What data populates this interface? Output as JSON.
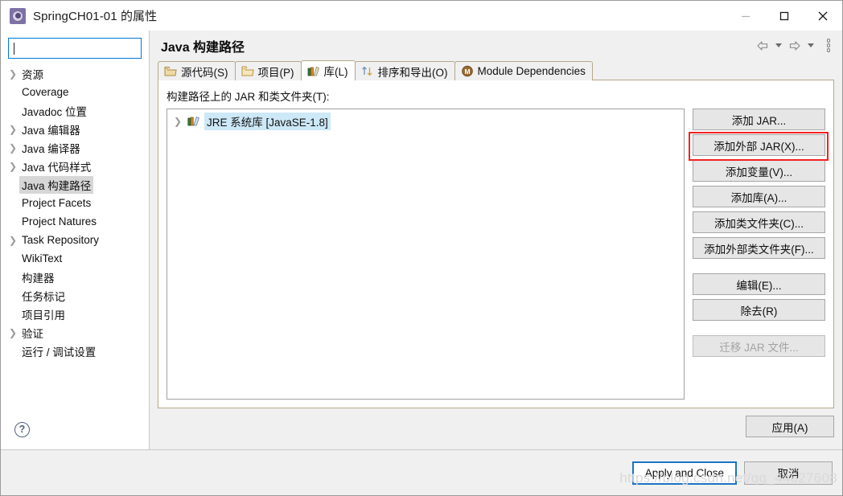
{
  "window": {
    "title": "SpringCH01-01 的属性",
    "icon": "properties-gear-icon",
    "controls": {
      "minimize": "minimize-icon",
      "maximize": "maximize-icon",
      "close": "close-icon"
    }
  },
  "sidebar": {
    "search": {
      "value": "",
      "placeholder": ""
    },
    "items": [
      {
        "label": "资源",
        "expandable": true,
        "selected": false
      },
      {
        "label": "Coverage",
        "expandable": false,
        "selected": false
      },
      {
        "label": "Javadoc 位置",
        "expandable": false,
        "selected": false
      },
      {
        "label": "Java 编辑器",
        "expandable": true,
        "selected": false
      },
      {
        "label": "Java 编译器",
        "expandable": true,
        "selected": false
      },
      {
        "label": "Java 代码样式",
        "expandable": true,
        "selected": false
      },
      {
        "label": "Java 构建路径",
        "expandable": false,
        "selected": true
      },
      {
        "label": "Project Facets",
        "expandable": false,
        "selected": false
      },
      {
        "label": "Project Natures",
        "expandable": false,
        "selected": false
      },
      {
        "label": "Task Repository",
        "expandable": true,
        "selected": false
      },
      {
        "label": "WikiText",
        "expandable": false,
        "selected": false
      },
      {
        "label": "构建器",
        "expandable": false,
        "selected": false
      },
      {
        "label": "任务标记",
        "expandable": false,
        "selected": false
      },
      {
        "label": "项目引用",
        "expandable": false,
        "selected": false
      },
      {
        "label": "验证",
        "expandable": true,
        "selected": false
      },
      {
        "label": "运行 / 调试设置",
        "expandable": false,
        "selected": false
      }
    ],
    "help_icon": "help-question-icon"
  },
  "page": {
    "title": "Java 构建路径",
    "nav": {
      "back": "back-arrow-icon",
      "back_menu": "chevron-down-icon",
      "forward": "forward-arrow-icon",
      "forward_menu": "chevron-down-icon",
      "menu": "kebab-menu-icon"
    }
  },
  "tabs": [
    {
      "label": "源代码(S)",
      "icon": "source-folder-icon",
      "active": false
    },
    {
      "label": "项目(P)",
      "icon": "project-folder-icon",
      "active": false
    },
    {
      "label": "库(L)",
      "icon": "library-books-icon",
      "active": true
    },
    {
      "label": "排序和导出(O)",
      "icon": "order-export-icon",
      "active": false
    },
    {
      "label": "Module Dependencies",
      "icon": "module-badge-icon",
      "active": false
    }
  ],
  "content": {
    "list_label": "构建路径上的 JAR 和类文件夹(T):",
    "entries": [
      {
        "label": "JRE 系统库 [JavaSE-1.8]",
        "icon": "jre-library-icon",
        "expandable": true,
        "selected": true
      }
    ]
  },
  "action_buttons": [
    {
      "label": "添加 JAR...",
      "name": "add-jar-button",
      "disabled": false,
      "highlighted": false,
      "gap_after": false
    },
    {
      "label": "添加外部 JAR(X)...",
      "name": "add-external-jar-button",
      "disabled": false,
      "highlighted": true,
      "gap_after": false
    },
    {
      "label": "添加变量(V)...",
      "name": "add-variable-button",
      "disabled": false,
      "highlighted": false,
      "gap_after": false
    },
    {
      "label": "添加库(A)...",
      "name": "add-library-button",
      "disabled": false,
      "highlighted": false,
      "gap_after": false
    },
    {
      "label": "添加类文件夹(C)...",
      "name": "add-class-folder-button",
      "disabled": false,
      "highlighted": false,
      "gap_after": false
    },
    {
      "label": "添加外部类文件夹(F)...",
      "name": "add-external-class-folder-button",
      "disabled": false,
      "highlighted": false,
      "gap_after": true
    },
    {
      "label": "编辑(E)...",
      "name": "edit-button",
      "disabled": false,
      "highlighted": false,
      "gap_after": false
    },
    {
      "label": "除去(R)",
      "name": "remove-button",
      "disabled": false,
      "highlighted": false,
      "gap_after": true
    },
    {
      "label": "迁移 JAR 文件...",
      "name": "migrate-jar-button",
      "disabled": true,
      "highlighted": false,
      "gap_after": false
    }
  ],
  "footer": {
    "apply": "应用(A)",
    "apply_and_close": "Apply and Close",
    "cancel": "取消",
    "watermark": "https://blog.csdn.net/qq_44627608"
  },
  "colors": {
    "accent_blue": "#0078d7",
    "focus_blue": "#1b74c4",
    "highlight_red": "#f42121",
    "selection_blue": "#cde8f7",
    "selection_gray": "#d6d6d6",
    "panel_gray": "#f0f0f0",
    "tab_border": "#b5a98c"
  }
}
